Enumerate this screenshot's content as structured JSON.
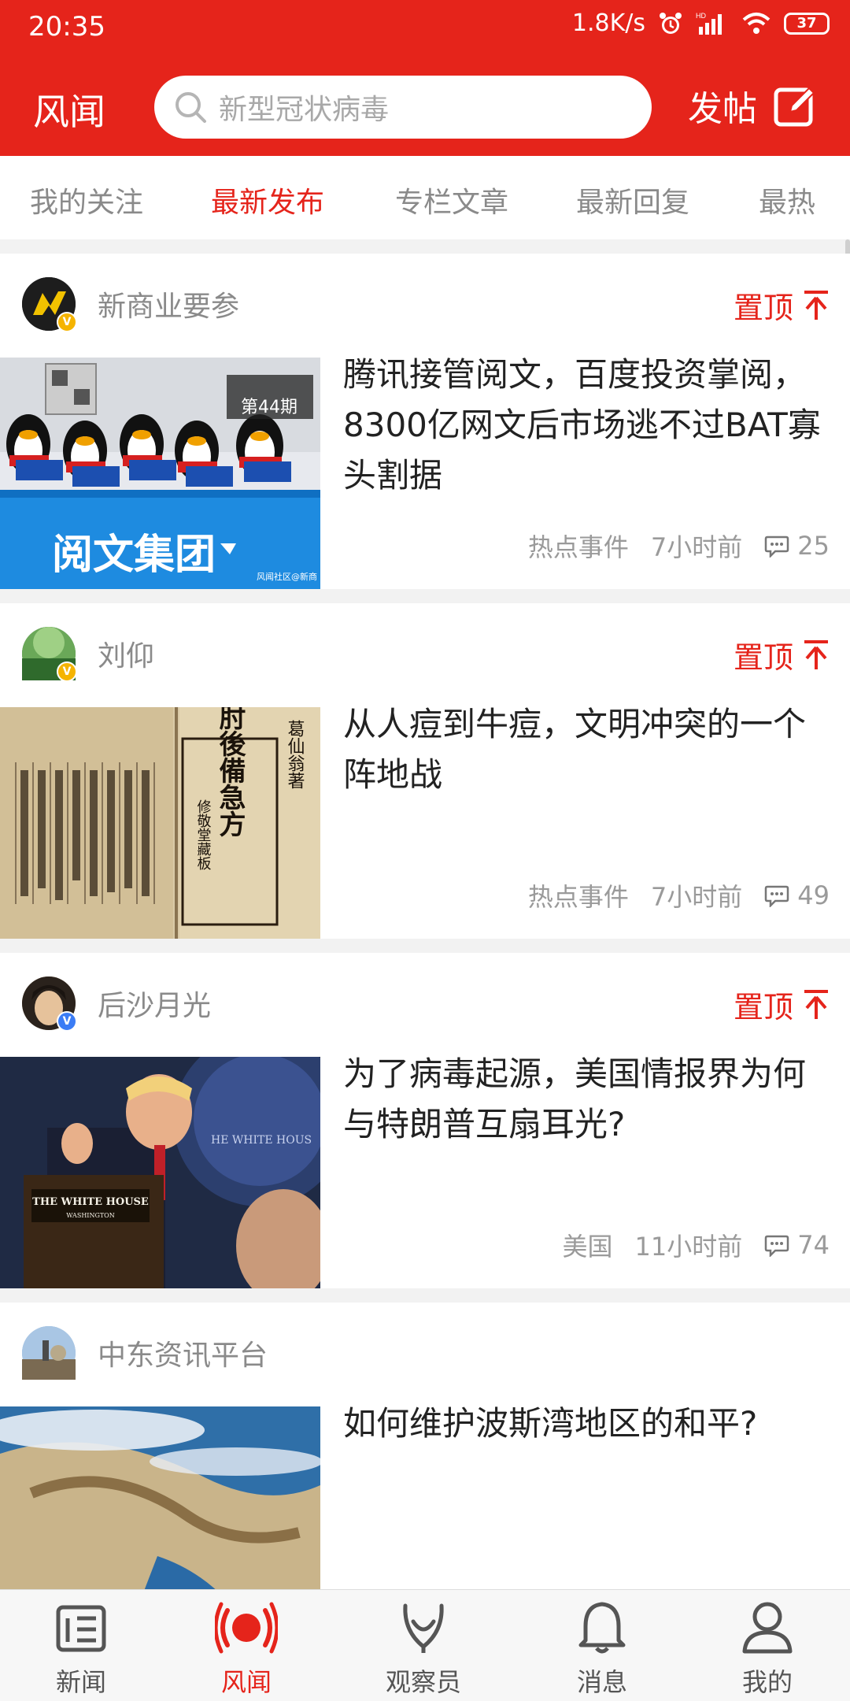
{
  "status_bar": {
    "time": "20:35",
    "speed": "1.8K/s",
    "battery": "37"
  },
  "header": {
    "brand": "风闻",
    "search_placeholder": "新型冠状病毒",
    "post_label": "发帖"
  },
  "tabs": [
    {
      "label": "我的关注",
      "active": false
    },
    {
      "label": "最新发布",
      "active": true
    },
    {
      "label": "专栏文章",
      "active": false
    },
    {
      "label": "最新回复",
      "active": false
    },
    {
      "label": "最热",
      "active": false
    }
  ],
  "feed": [
    {
      "author": "新商业要参",
      "pinned": true,
      "pin_label": "置顶",
      "verified": "gold",
      "title": "腾讯接管阅文，百度投资掌阅，8300亿网文后市场逃不过BAT寡头割据",
      "tag": "热点事件",
      "time": "7小时前",
      "comments": "25",
      "image_text": "阅文集团",
      "image_badge": "第44期",
      "image_watermark": "风闻社区@新商"
    },
    {
      "author": "刘仰",
      "pinned": true,
      "pin_label": "置顶",
      "verified": "gold",
      "title": "从人痘到牛痘，文明冲突的一个阵地战",
      "tag": "热点事件",
      "time": "7小时前",
      "comments": "49",
      "image_text": "肘後備急方",
      "image_sub": "修敬堂藏板",
      "image_side": "葛仙翁著"
    },
    {
      "author": "后沙月光",
      "pinned": true,
      "pin_label": "置顶",
      "verified": "blue",
      "title": "为了病毒起源，美国情报界为何与特朗普互扇耳光?",
      "tag": "美国",
      "time": "11小时前",
      "comments": "74",
      "image_text": "THE WHITE HOUSE",
      "image_sub": "WASHINGTON",
      "image_backdrop": "HE WHITE HOUS"
    },
    {
      "author": "中东资讯平台",
      "pinned": false,
      "pin_label": "",
      "verified": "",
      "title": "如何维护波斯湾地区的和平?",
      "tag": "",
      "time": "",
      "comments": ""
    }
  ],
  "bottom_nav": [
    {
      "label": "新闻",
      "icon": "newspaper-icon",
      "active": false
    },
    {
      "label": "风闻",
      "icon": "broadcast-icon",
      "active": true
    },
    {
      "label": "观察员",
      "icon": "observer-icon",
      "active": false
    },
    {
      "label": "消息",
      "icon": "bell-icon",
      "active": false
    },
    {
      "label": "我的",
      "icon": "person-icon",
      "active": false
    }
  ],
  "colors": {
    "accent": "#e5241b",
    "gold_badge": "#f5b400",
    "blue_badge": "#3b7cf5"
  }
}
